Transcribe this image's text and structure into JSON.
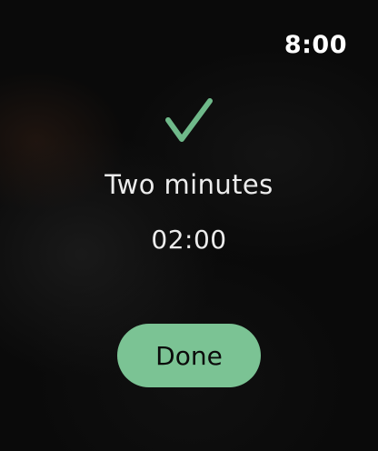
{
  "status_bar": {
    "time": "8:00"
  },
  "confirmation": {
    "icon": "checkmark-icon",
    "icon_color": "#6fb98a"
  },
  "timer": {
    "name": "Two minutes",
    "duration": "02:00"
  },
  "actions": {
    "done_label": "Done",
    "done_color": "#7bc394"
  }
}
